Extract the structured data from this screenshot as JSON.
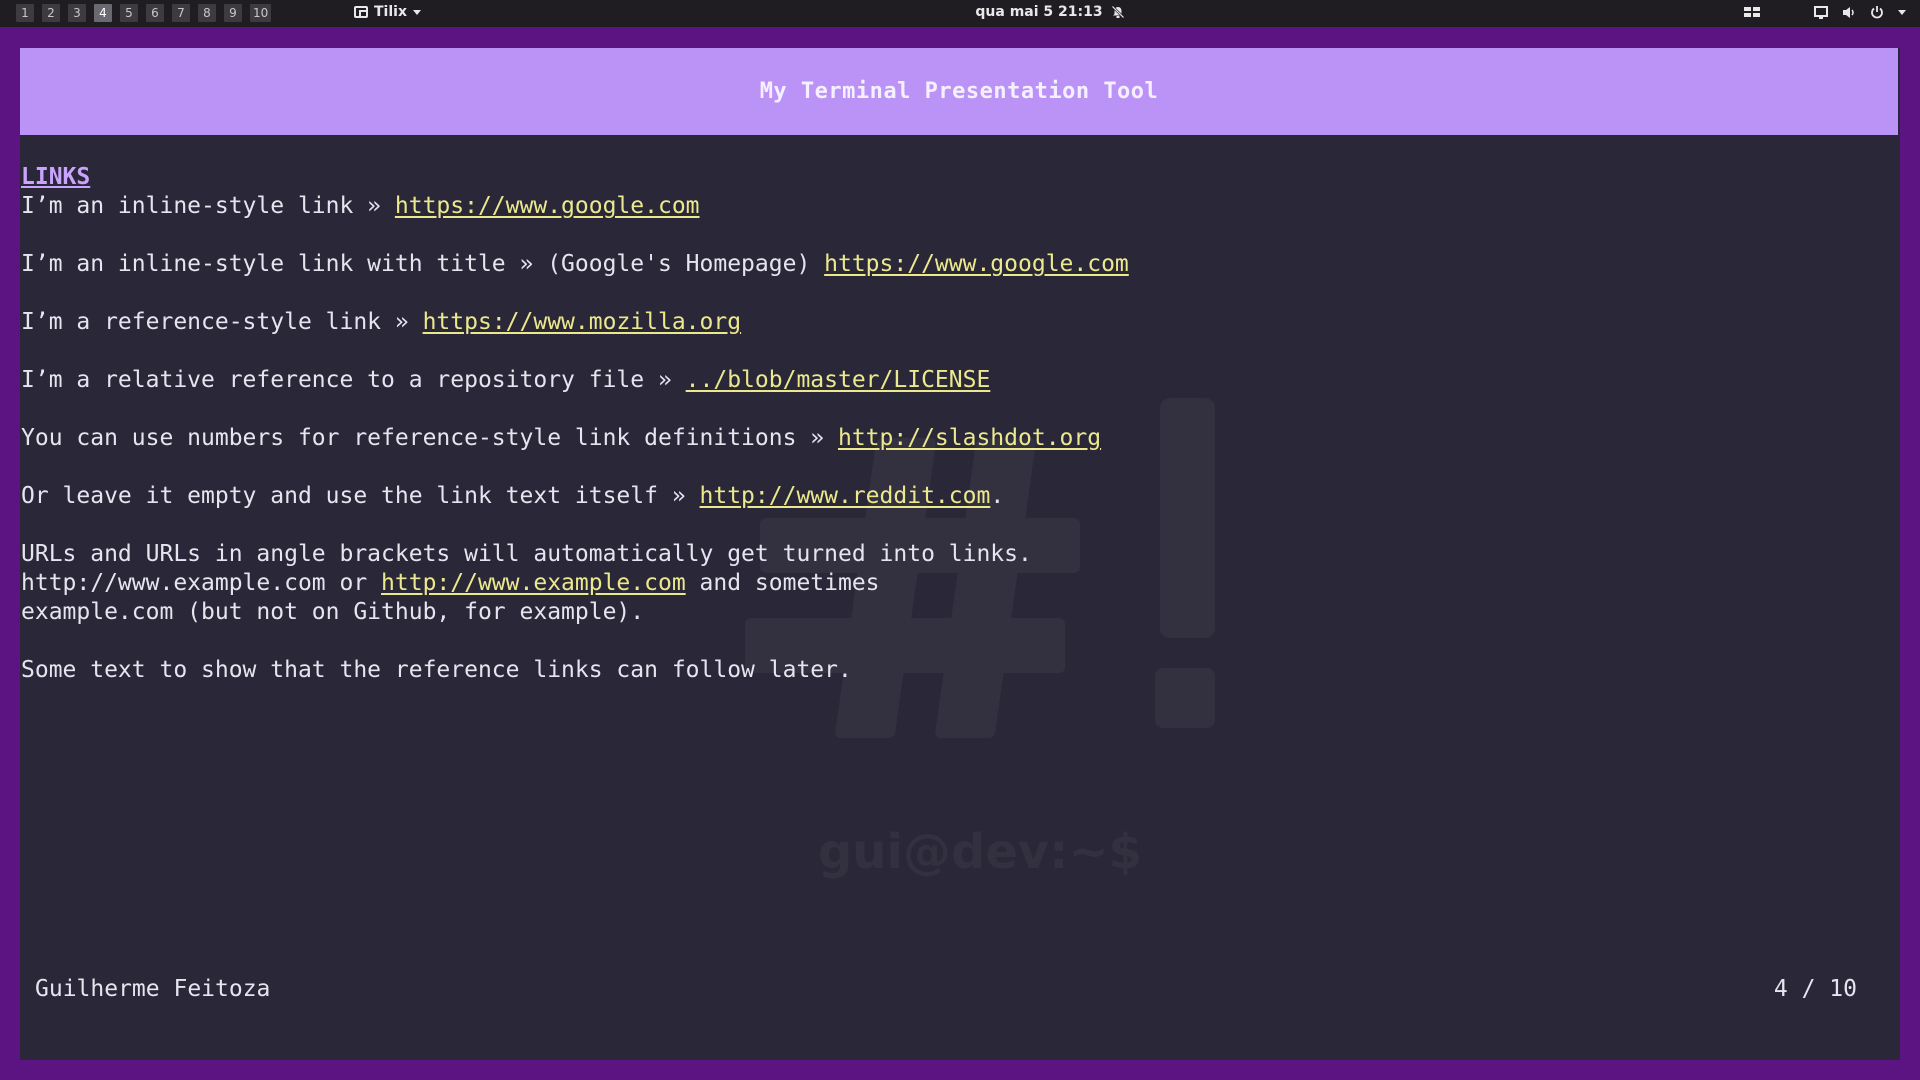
{
  "topbar": {
    "workspaces": [
      "1",
      "2",
      "3",
      "4",
      "5",
      "6",
      "7",
      "8",
      "9",
      "10"
    ],
    "active_workspace": "4",
    "app_name": "Tilix",
    "clock": "qua mai 5  21:13"
  },
  "slide": {
    "header_title": "My Terminal Presentation Tool",
    "section_heading": "LINKS",
    "lines": {
      "l1_text": "I’m an inline-style link » ",
      "l1_link": "https://www.google.com",
      "l2_text": "I’m an inline-style link with title » (Google's Homepage) ",
      "l2_link": "https://www.google.com",
      "l3_text": "I’m a reference-style link » ",
      "l3_link": "https://www.mozilla.org",
      "l4_text": "I’m a relative reference to a repository file » ",
      "l4_link": "../blob/master/LICENSE",
      "l5_text": "You can use numbers for reference-style link definitions » ",
      "l5_link": "http://slashdot.org",
      "l6_text": "Or leave it empty and use the link text itself » ",
      "l6_link": "http://www.reddit.com",
      "l6_after": ".",
      "l7_text": "URLs and URLs in angle brackets will automatically get turned into links.",
      "l8_before": "http://www.example.com or ",
      "l8_link": "http://www.example.com",
      "l8_after": " and sometimes",
      "l9_text": "example.com (but not on Github, for example).",
      "l10_text": "Some text to show that the reference links can follow later."
    },
    "watermark_prompt": "gui@dev:~$",
    "author": "Guilherme Feitoza",
    "page_indicator": "4 / 10"
  },
  "colors": {
    "desktop_bg": "#5b1481",
    "terminal_bg": "#2a2838",
    "header_bg": "#bb93f7",
    "link": "#ece88d",
    "heading": "#c9a4ff"
  }
}
